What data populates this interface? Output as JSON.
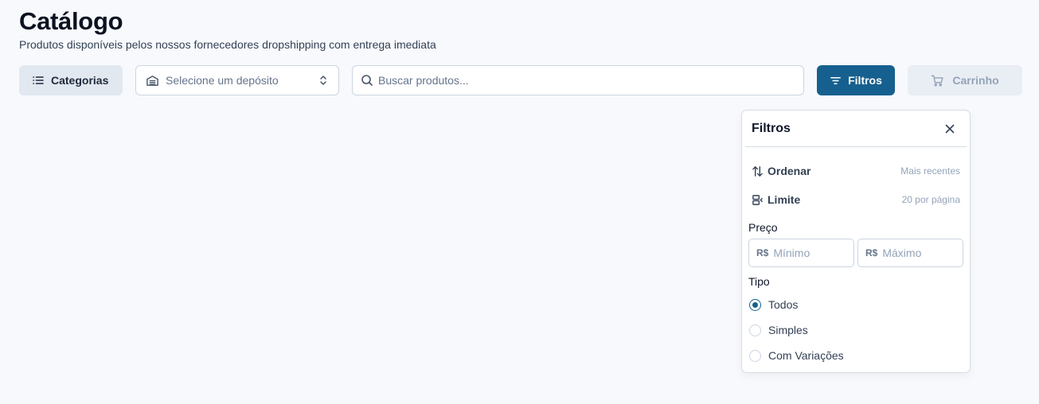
{
  "header": {
    "title": "Catálogo",
    "subtitle": "Produtos disponíveis pelos nossos fornecedores dropshipping com entrega imediata"
  },
  "toolbar": {
    "categories_label": "Categorias",
    "depot_placeholder": "Selecione um depósito",
    "search_placeholder": "Buscar produtos...",
    "filters_label": "Filtros",
    "cart_label": "Carrinho"
  },
  "filters_panel": {
    "title": "Filtros",
    "sort": {
      "label": "Ordenar",
      "value": "Mais recentes"
    },
    "limit": {
      "label": "Limite",
      "value": "20 por página"
    },
    "price": {
      "label": "Preço",
      "currency": "R$",
      "min_placeholder": "Mínimo",
      "max_placeholder": "Máximo"
    },
    "type": {
      "label": "Tipo",
      "options": [
        {
          "label": "Todos",
          "selected": true
        },
        {
          "label": "Simples",
          "selected": false
        },
        {
          "label": "Com Variações",
          "selected": false
        }
      ]
    }
  },
  "colors": {
    "accent": "#16608f",
    "background": "#f7f9fc",
    "muted_text": "#64748b"
  }
}
